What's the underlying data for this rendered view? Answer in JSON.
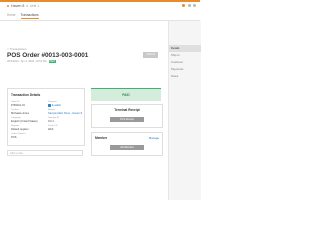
{
  "topbar": {
    "store": "Haven 8",
    "substore": "Unit 1",
    "accent_color": "#e88b2a"
  },
  "tabs": [
    {
      "label": "Home"
    },
    {
      "label": "Transactions"
    }
  ],
  "sidebar": {
    "items": [
      {
        "label": "Details"
      },
      {
        "label": "Ship to"
      },
      {
        "label": "Customer"
      },
      {
        "label": "Payments"
      },
      {
        "label": "Notes"
      }
    ]
  },
  "page": {
    "breadcrumb": "< Transactions",
    "title": "POS Order #0013-003-0001",
    "meta_date": "30/1/2024 · Apr 4, 2024, 10:51 AM",
    "meta_status": "PAID",
    "actions_label": "Actions"
  },
  "transaction_details": {
    "title": "Transaction Details",
    "fields": [
      {
        "label": "Order ID",
        "value": "#765201-01",
        "link": false
      },
      {
        "label": "Payment",
        "value": "E-wallet",
        "link": true
      },
      {
        "label": "Cashier",
        "value": "Michaela Jones",
        "link": false
      },
      {
        "label": "Branch",
        "value": "Sample Main Store - Haven 8",
        "link": true
      },
      {
        "label": "Language",
        "value": "English (United States)",
        "link": false
      },
      {
        "label": "Terminal ID",
        "value": "0.0.1",
        "link": false
      },
      {
        "label": "Register",
        "value": "Default register",
        "link": false
      },
      {
        "label": "Device ID",
        "value": "Web",
        "link": false
      },
      {
        "label": "Order Channel",
        "value": "POS",
        "link": false
      }
    ]
  },
  "note": {
    "placeholder": "Add a note..."
  },
  "paid": {
    "label": "PAID"
  },
  "terminal_receipt": {
    "title": "Terminal Receipt",
    "button": "Print Receipt"
  },
  "member": {
    "title": "Member",
    "manage": "Manage",
    "button": "Add Member"
  }
}
